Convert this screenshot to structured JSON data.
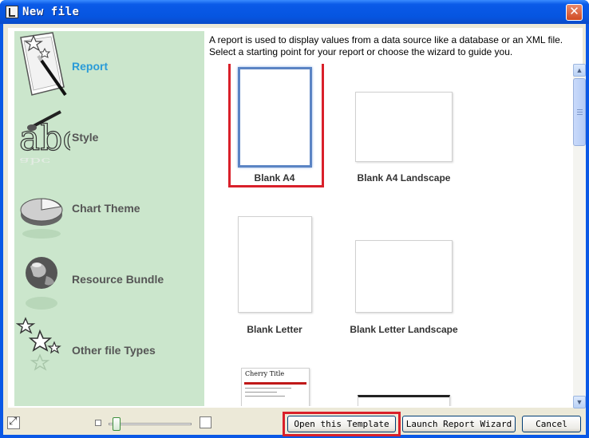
{
  "window": {
    "title": "New file"
  },
  "description": {
    "line1": "A report is used to display values from a data source like a database or an XML file.",
    "line2": "Select a starting point for your report or choose the wizard to guide you."
  },
  "categories": [
    {
      "label": "Report",
      "icon": "report-icon",
      "selected": true
    },
    {
      "label": "Style",
      "icon": "style-icon",
      "selected": false
    },
    {
      "label": "Chart Theme",
      "icon": "chart-theme-icon",
      "selected": false
    },
    {
      "label": "Resource Bundle",
      "icon": "resource-bundle-icon",
      "selected": false
    },
    {
      "label": "Other file Types",
      "icon": "other-file-types-icon",
      "selected": false
    }
  ],
  "templates": [
    {
      "label": "Blank A4",
      "selected": true
    },
    {
      "label": "Blank A4 Landscape",
      "selected": false
    },
    {
      "label": "Blank Letter",
      "selected": false
    },
    {
      "label": "Blank Letter Landscape",
      "selected": false
    },
    {
      "label": "Cherry Title",
      "selected": false
    }
  ],
  "buttons": {
    "open_template": "Open this Template",
    "launch_wizard": "Launch Report Wizard",
    "cancel": "Cancel"
  },
  "zoom": {
    "level": 0.05
  },
  "colors": {
    "accent": "#2a9bd8",
    "sidebar_bg": "#cbe6cc",
    "highlight": "#d9202a",
    "title_bar": "#0a5ae8"
  }
}
